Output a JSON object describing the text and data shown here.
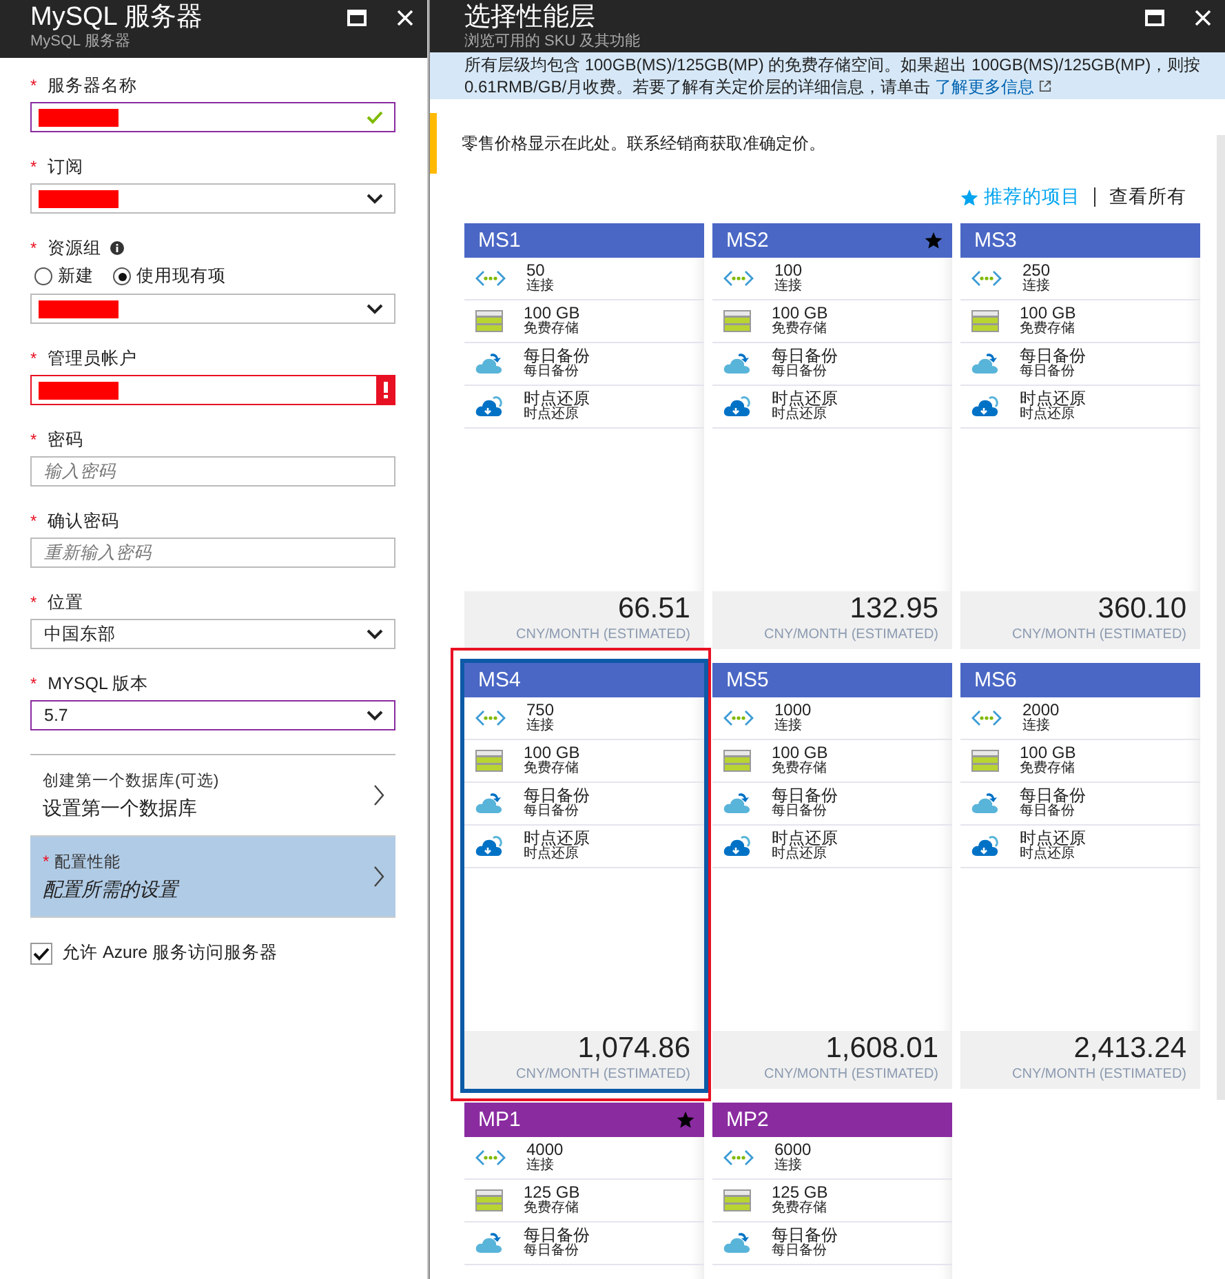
{
  "left_panel": {
    "title": "MySQL 服务器",
    "subtitle": "MySQL 服务器",
    "fields": [
      {
        "kind": "text",
        "label": "服务器名称",
        "required_mark": "*",
        "redacted": true,
        "focused": true,
        "valid": true,
        "invalid": false
      },
      {
        "kind": "select",
        "label": "订阅",
        "required_mark": "*",
        "redacted": true,
        "focused": false
      },
      {
        "kind": "radio-select",
        "label": "资源组",
        "required_mark": "*",
        "info": true,
        "options": [
          {
            "label": "新建",
            "selected": false
          },
          {
            "label": "使用现有项",
            "selected": true
          }
        ],
        "redacted": true,
        "focused": false
      },
      {
        "kind": "text",
        "label": "管理员帐户",
        "required_mark": "*",
        "redacted": true,
        "focused": false,
        "valid": false,
        "invalid": true
      },
      {
        "kind": "text",
        "label": "密码",
        "required_mark": "*",
        "placeholder": "输入密码",
        "focused": false
      },
      {
        "kind": "text",
        "label": "确认密码",
        "required_mark": "*",
        "placeholder": "重新输入密码",
        "focused": false
      },
      {
        "kind": "select",
        "label": "位置",
        "required_mark": "*",
        "value": "中国东部",
        "focused": false
      },
      {
        "kind": "select",
        "label": "MYSQL 版本",
        "required_mark": "*",
        "value": "5.7",
        "focused": true
      }
    ],
    "nav_items": [
      {
        "caption": "创建第一个数据库(可选)",
        "value": "设置第一个数据库",
        "selected": false
      },
      {
        "caption": "配置性能",
        "placeholder": "配置所需的设置",
        "required_mark": "*",
        "selected": true
      }
    ],
    "checkbox": {
      "label": "允许 Azure 服务访问服务器",
      "checked": true
    }
  },
  "right_panel": {
    "title": "选择性能层",
    "subtitle": "浏览可用的 SKU 及其功能",
    "notice": {
      "text": "所有层级均包含 100GB(MS)/125GB(MP) 的免费存储空间。如果超出 100GB(MS)/125GB(MP)，则按 0.61RMB/GB/月收费。若要了解有关定价层的详细信息，请单击",
      "link": "了解更多信息"
    },
    "warning": "零售价格显示在此处。联系经销商获取准确定价。",
    "filters": [
      {
        "label": "推荐的项目",
        "selected": true
      },
      {
        "label": "查看所有",
        "selected": false
      }
    ],
    "cards": [
      {
        "name": "MS1",
        "color": "#4a67c5",
        "recommended": false,
        "selected": false,
        "annotated": false,
        "features": [
          {
            "kind": "connections",
            "value": "50",
            "label": "连接"
          },
          {
            "kind": "storage",
            "value": "100 GB",
            "label": "免费存储"
          },
          {
            "kind": "backup",
            "value": "每日备份",
            "label": "每日备份"
          },
          {
            "kind": "restore",
            "value": "时点还原",
            "label": "时点还原"
          }
        ],
        "price": "66.51",
        "unit": "CNY/MONTH (ESTIMATED)"
      },
      {
        "name": "MS2",
        "color": "#4a67c5",
        "recommended": true,
        "selected": false,
        "annotated": false,
        "features": [
          {
            "kind": "connections",
            "value": "100",
            "label": "连接"
          },
          {
            "kind": "storage",
            "value": "100 GB",
            "label": "免费存储"
          },
          {
            "kind": "backup",
            "value": "每日备份",
            "label": "每日备份"
          },
          {
            "kind": "restore",
            "value": "时点还原",
            "label": "时点还原"
          }
        ],
        "price": "132.95",
        "unit": "CNY/MONTH (ESTIMATED)"
      },
      {
        "name": "MS3",
        "color": "#4a67c5",
        "recommended": false,
        "selected": false,
        "annotated": false,
        "features": [
          {
            "kind": "connections",
            "value": "250",
            "label": "连接"
          },
          {
            "kind": "storage",
            "value": "100 GB",
            "label": "免费存储"
          },
          {
            "kind": "backup",
            "value": "每日备份",
            "label": "每日备份"
          },
          {
            "kind": "restore",
            "value": "时点还原",
            "label": "时点还原"
          }
        ],
        "price": "360.10",
        "unit": "CNY/MONTH (ESTIMATED)"
      },
      {
        "name": "MS4",
        "color": "#4a67c5",
        "recommended": false,
        "selected": true,
        "annotated": true,
        "features": [
          {
            "kind": "connections",
            "value": "750",
            "label": "连接"
          },
          {
            "kind": "storage",
            "value": "100 GB",
            "label": "免费存储"
          },
          {
            "kind": "backup",
            "value": "每日备份",
            "label": "每日备份"
          },
          {
            "kind": "restore",
            "value": "时点还原",
            "label": "时点还原"
          }
        ],
        "price": "1,074.86",
        "unit": "CNY/MONTH (ESTIMATED)"
      },
      {
        "name": "MS5",
        "color": "#4a67c5",
        "recommended": false,
        "selected": false,
        "annotated": false,
        "features": [
          {
            "kind": "connections",
            "value": "1000",
            "label": "连接"
          },
          {
            "kind": "storage",
            "value": "100 GB",
            "label": "免费存储"
          },
          {
            "kind": "backup",
            "value": "每日备份",
            "label": "每日备份"
          },
          {
            "kind": "restore",
            "value": "时点还原",
            "label": "时点还原"
          }
        ],
        "price": "1,608.01",
        "unit": "CNY/MONTH (ESTIMATED)"
      },
      {
        "name": "MS6",
        "color": "#4a67c5",
        "recommended": false,
        "selected": false,
        "annotated": false,
        "features": [
          {
            "kind": "connections",
            "value": "2000",
            "label": "连接"
          },
          {
            "kind": "storage",
            "value": "100 GB",
            "label": "免费存储"
          },
          {
            "kind": "backup",
            "value": "每日备份",
            "label": "每日备份"
          },
          {
            "kind": "restore",
            "value": "时点还原",
            "label": "时点还原"
          }
        ],
        "price": "2,413.24",
        "unit": "CNY/MONTH (ESTIMATED)"
      },
      {
        "name": "MP1",
        "color": "#8a2ba0",
        "recommended": true,
        "selected": false,
        "annotated": false,
        "features": [
          {
            "kind": "connections",
            "value": "4000",
            "label": "连接"
          },
          {
            "kind": "storage",
            "value": "125 GB",
            "label": "免费存储"
          },
          {
            "kind": "backup",
            "value": "每日备份",
            "label": "每日备份"
          }
        ]
      },
      {
        "name": "MP2",
        "color": "#8a2ba0",
        "recommended": false,
        "selected": false,
        "annotated": false,
        "features": [
          {
            "kind": "connections",
            "value": "6000",
            "label": "连接"
          },
          {
            "kind": "storage",
            "value": "125 GB",
            "label": "免费存储"
          },
          {
            "kind": "backup",
            "value": "每日备份",
            "label": "每日备份"
          }
        ]
      }
    ]
  }
}
